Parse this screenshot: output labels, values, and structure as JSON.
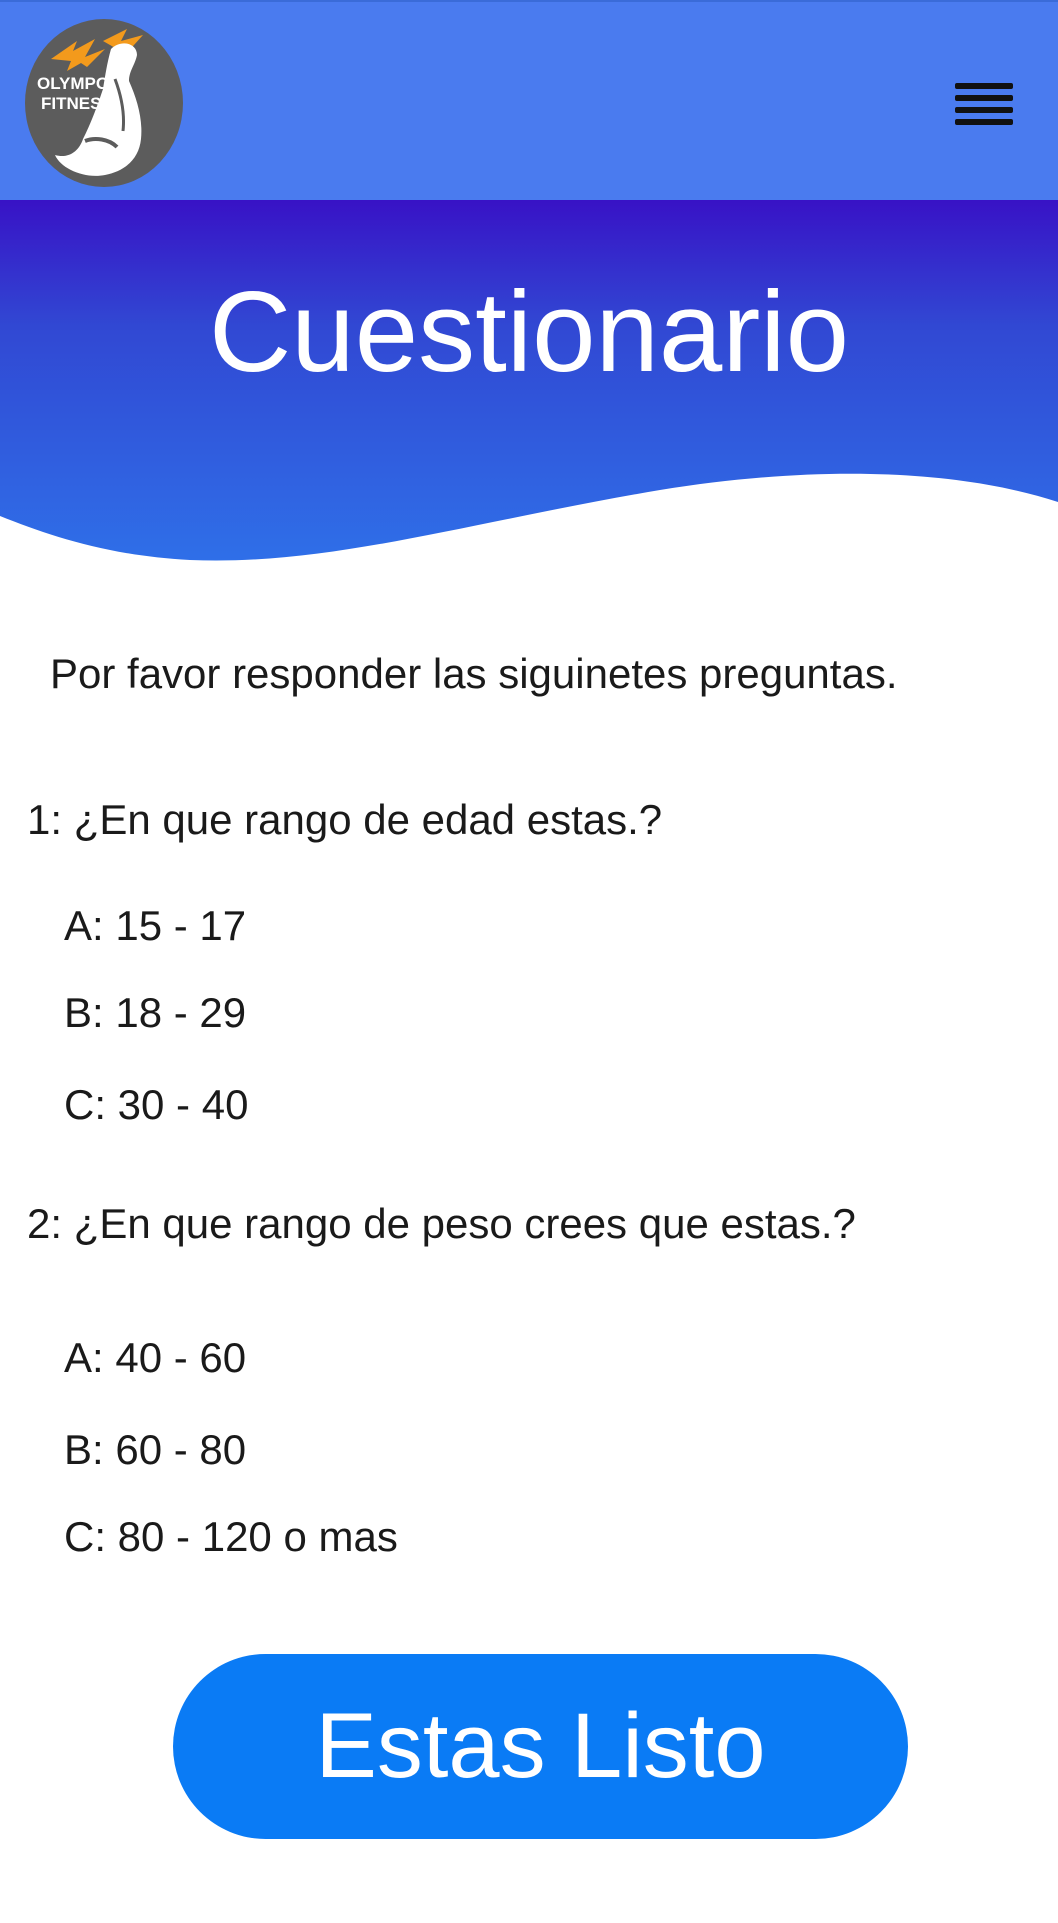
{
  "brand": {
    "logo_text": "OLYMPO FITNESS"
  },
  "colors": {
    "topbar": "#4a7bef",
    "hero_top": "#3812c6",
    "hero_bottom": "#2f6fe8",
    "button": "#0a7bf5"
  },
  "header": {
    "menu_icon": "hamburger-menu-icon"
  },
  "hero": {
    "title": "Cuestionario"
  },
  "intro": "Por favor responder las siguinetes preguntas.",
  "questions": [
    {
      "text": "1: ¿En que rango de edad estas.?",
      "options": [
        "A: 15 - 17",
        "B: 18 - 29",
        "C: 30 - 40"
      ]
    },
    {
      "text": "2: ¿En que rango de peso crees que estas.?",
      "options": [
        "A: 40 - 60",
        "B: 60 - 80",
        "C: 80 - 120 o mas"
      ]
    }
  ],
  "cta": {
    "label": "Estas Listo"
  }
}
